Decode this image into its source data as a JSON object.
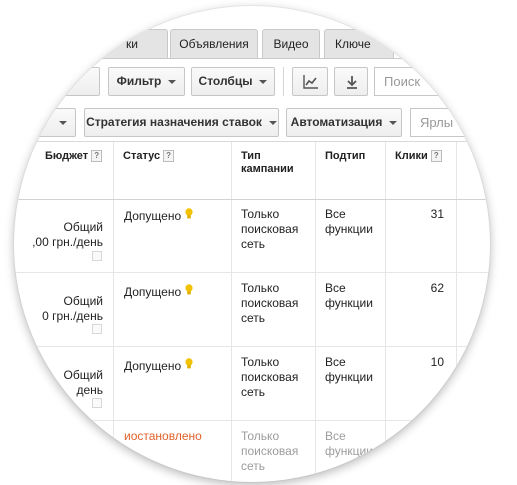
{
  "tabs": [
    {
      "label": "ки"
    },
    {
      "label": "Объявления"
    },
    {
      "label": "Видео"
    },
    {
      "label": "Ключе"
    }
  ],
  "toolbar": {
    "filter_label": "Фильтр",
    "columns_label": "Столбцы",
    "search_placeholder": "Поиск",
    "bid_strategy_label": "Стратегия назначения ставок",
    "automation_label": "Автоматизация",
    "labels_placeholder": "Ярлы"
  },
  "table": {
    "headers": {
      "budget": "Бюджет",
      "status": "Статус",
      "campaign_type_line1": "Тип",
      "campaign_type_line2": "кампании",
      "subtype": "Подтип",
      "clicks": "Клики",
      "help_glyph": "?"
    },
    "rows": [
      {
        "budget_line1": "Общий",
        "budget_line2": ",00 грн./день",
        "status": "Допущено",
        "type_l1": "Только",
        "type_l2": "поисковая",
        "type_l3": "сеть",
        "subtype_l1": "Все",
        "subtype_l2": "функции",
        "clicks": "31"
      },
      {
        "budget_line1": "Общий",
        "budget_line2": "0 грн./день",
        "status": "Допущено",
        "type_l1": "Только",
        "type_l2": "поисковая",
        "type_l3": "сеть",
        "subtype_l1": "Все",
        "subtype_l2": "функции",
        "clicks": "62"
      },
      {
        "budget_line1": "Общий",
        "budget_line2": "день",
        "status": "Допущено",
        "type_l1": "Только",
        "type_l2": "поисковая",
        "type_l3": "сеть",
        "subtype_l1": "Все",
        "subtype_l2": "функции",
        "clicks": "10"
      },
      {
        "status": "иостановлено",
        "type_l1": "Только",
        "type_l2": "поисковая",
        "type_l3": "сеть",
        "subtype_l1": "Все",
        "subtype_l2": "функции"
      }
    ]
  },
  "colors": {
    "paused_status": "#e0622a",
    "approved_bulb": "#f2c200",
    "tab_bg": "#e4e4e4"
  }
}
